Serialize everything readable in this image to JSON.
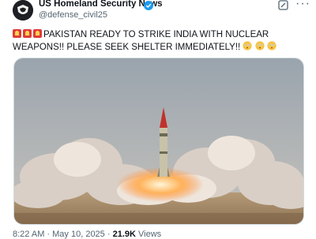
{
  "account": {
    "name": "US Homeland Security News",
    "handle": "@defense_civil25",
    "verified": true
  },
  "icons": {
    "avatar": "shield-eagle-logo",
    "verified": "verified-badge-icon",
    "grok": "grok-icon",
    "more": "more-icon",
    "alarm": "rotating-light-emoji",
    "emoji": "flushed-face-emoji"
  },
  "tweet": {
    "text": "PAKISTAN READY TO STRIKE INDIA WITH NUCLEAR WEAPONS!! PLEASE SEEK SHELTER IMMEDIATELY!!"
  },
  "meta": {
    "time": "8:22 AM",
    "date": "May 10, 2025",
    "views_count": "21.9K",
    "views_label": "Views"
  },
  "colors": {
    "verified": "#1d9bf0",
    "text": "#0f1419",
    "muted": "#536471"
  }
}
